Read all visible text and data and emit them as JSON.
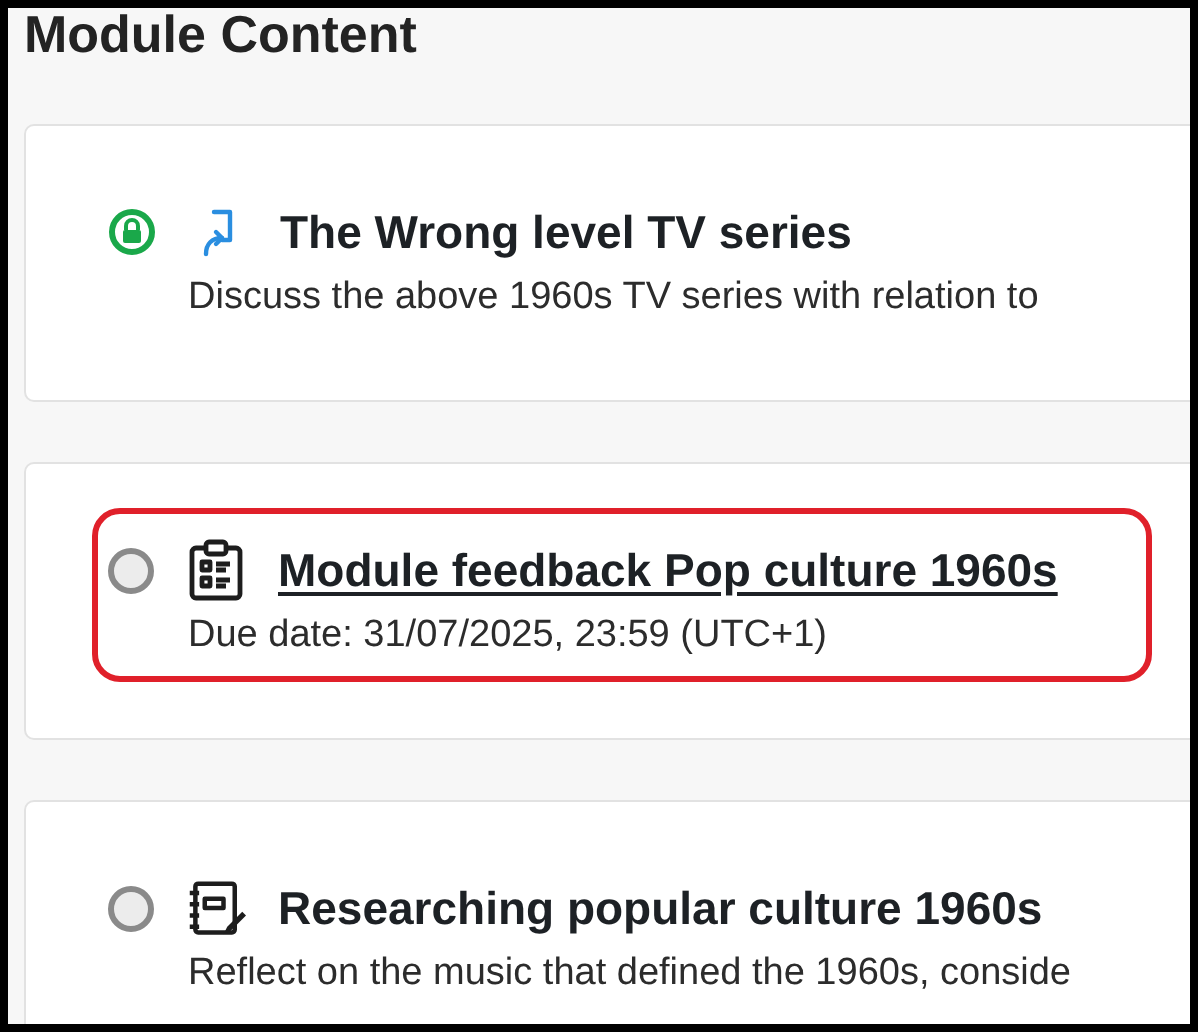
{
  "heading": "Module Content",
  "items": [
    {
      "kind": "link",
      "locked": true,
      "title": "The Wrong level TV series",
      "underlined": false,
      "highlighted": false,
      "detail": "Discuss the above 1960s TV series with relation to"
    },
    {
      "kind": "feedback",
      "locked": false,
      "title": "Module feedback Pop culture 1960s",
      "underlined": true,
      "highlighted": true,
      "detail": "Due date: 31/07/2025, 23:59 (UTC+1)"
    },
    {
      "kind": "journal",
      "locked": false,
      "title": "Researching popular culture 1960s",
      "underlined": false,
      "highlighted": false,
      "detail": "Reflect on the music that defined the 1960s, conside"
    }
  ]
}
